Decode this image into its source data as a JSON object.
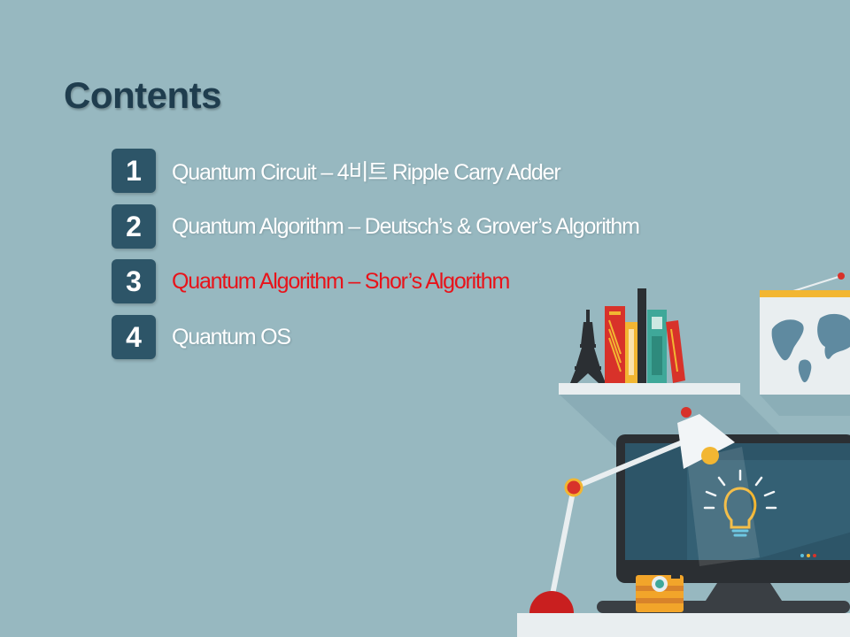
{
  "slide": {
    "title": "Contents",
    "items": [
      {
        "number": "1",
        "label": "Quantum Circuit  –  4비트 Ripple Carry Adder",
        "active": false
      },
      {
        "number": "2",
        "label": "Quantum Algorithm  – Deutsch’s  & Grover’s  Algorithm",
        "active": false
      },
      {
        "number": "3",
        "label": "Quantum Algorithm  – Shor’s Algorithm",
        "active": true
      },
      {
        "number": "4",
        "label": "Quantum OS",
        "active": false
      }
    ]
  },
  "colors": {
    "background": "#97b8c0",
    "title": "#1f3d4e",
    "number_box": "#2d5568",
    "active_text": "#e8131a",
    "default_text": "#ffffff"
  },
  "illustration": {
    "icons": [
      "eiffel-tower-icon",
      "books-icon",
      "world-map-icon",
      "desk-lamp-icon",
      "monitor-icon",
      "lightbulb-icon",
      "camera-icon"
    ]
  }
}
